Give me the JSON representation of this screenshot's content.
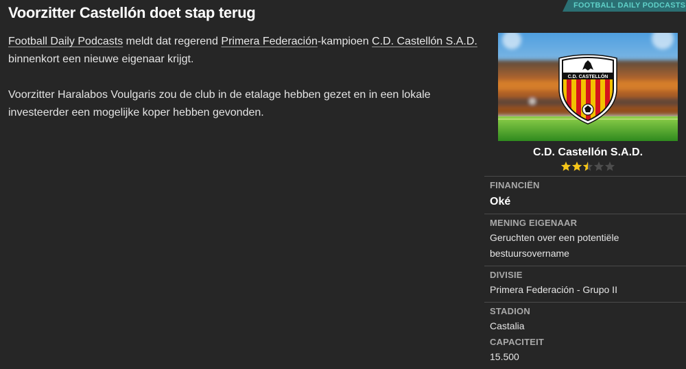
{
  "source_tab": "FOOTBALL DAILY PODCASTS",
  "headline": "Voorzitter Castellón doet stap terug",
  "article": {
    "p1": {
      "link_source": "Football Daily Podcasts",
      "text_a": " meldt dat regerend ",
      "link_league": "Primera Federación",
      "text_b": "-kampioen ",
      "link_club": "C.D. Castellón S.A.D.",
      "text_c": " binnenkort een nieuwe eigenaar krijgt."
    },
    "p2": "Voorzitter Haralabos Voulgaris zou de club in de etalage hebben gezet en in een lokale investeerder een mogelijke koper hebben gevonden."
  },
  "club": {
    "name": "C.D. Castellón S.A.D.",
    "crest_text": "C.D. CASTELLÓN",
    "rating": 2.5,
    "rating_max": 5,
    "star_color": "#f5c518",
    "star_empty_color": "#4d4d4d"
  },
  "info": {
    "finances_label": "FINANCIËN",
    "finances_value": "Oké",
    "owner_label": "MENING EIGENAAR",
    "owner_value": "Geruchten over een potentiële bestuursovername",
    "division_label": "DIVISIE",
    "division_value": "Primera Federación - Grupo II",
    "stadium_label": "STADION",
    "stadium_value": "Castalia",
    "capacity_label": "CAPACITEIT",
    "capacity_value": "15.500"
  }
}
